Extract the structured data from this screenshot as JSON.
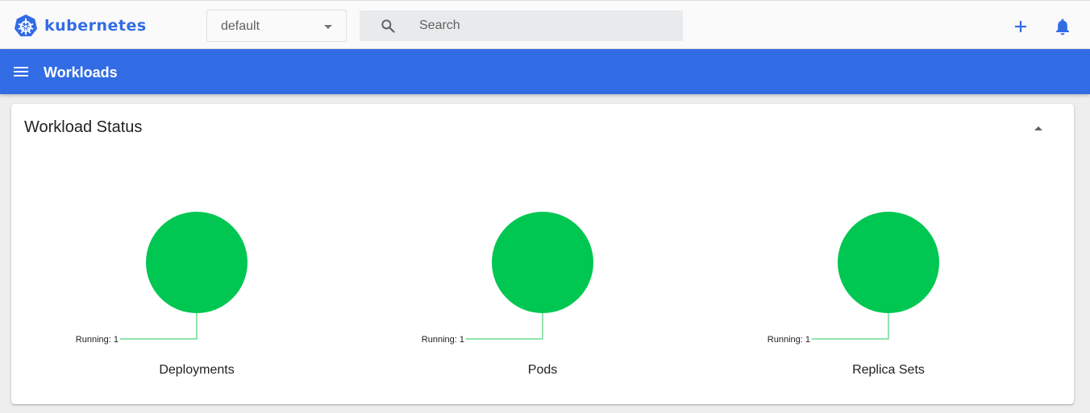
{
  "header": {
    "brand": "kubernetes",
    "namespace": "default",
    "search_placeholder": "Search"
  },
  "nav": {
    "title": "Workloads"
  },
  "card": {
    "title": "Workload Status",
    "graphs": [
      {
        "label": "Deployments",
        "legend": "Running: 1",
        "running": 1
      },
      {
        "label": "Pods",
        "legend": "Running: 1",
        "running": 1
      },
      {
        "label": "Replica Sets",
        "legend": "Running: 1",
        "running": 1
      }
    ]
  },
  "colors": {
    "brand": "#326ce5",
    "running": "#00c752",
    "leader_line": "#6edb93"
  },
  "icons": [
    "kubernetes-logo-icon",
    "chevron-down-icon",
    "search-icon",
    "add-icon",
    "bell-icon",
    "menu-icon",
    "collapse-icon"
  ]
}
